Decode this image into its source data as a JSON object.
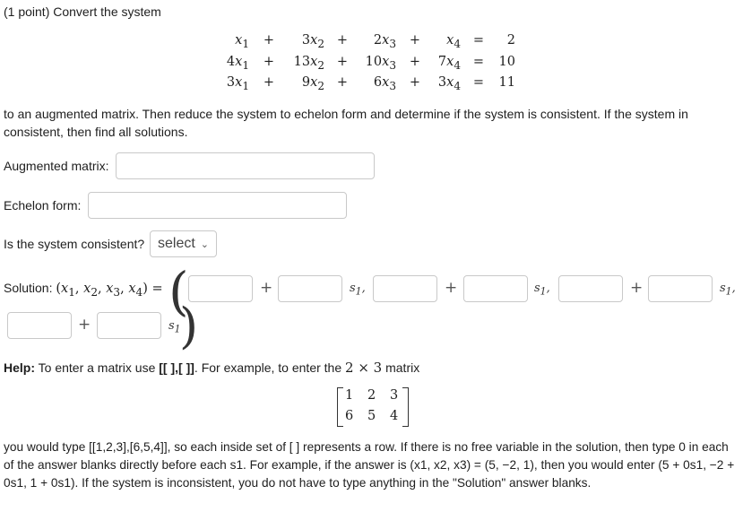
{
  "problem": {
    "points": "(1 point) Convert the system",
    "equations": [
      {
        "a": "x1",
        "op1": "+",
        "b": "3x2",
        "op2": "+",
        "c": "2x3",
        "op3": "+",
        "d": "x4",
        "eq": "=",
        "rhs": "2"
      },
      {
        "a": "4x1",
        "op1": "+",
        "b": "13x2",
        "op2": "+",
        "c": "10x3",
        "op3": "+",
        "d": "7x4",
        "eq": "=",
        "rhs": "10"
      },
      {
        "a": "3x1",
        "op1": "+",
        "b": "9x2",
        "op2": "+",
        "c": "6x3",
        "op3": "+",
        "d": "3x4",
        "eq": "=",
        "rhs": "11"
      }
    ],
    "instructions": "to an augmented matrix. Then reduce the system to echelon form and determine if the system is consistent. If the system in consistent, then find all solutions."
  },
  "form": {
    "augmented_label": "Augmented matrix:",
    "echelon_label": "Echelon form:",
    "consistent_label": "Is the system consistent?",
    "consistent_select": "select",
    "solution_label": "Solution:",
    "solution_tuple": "(x1, x2, x3, x4) =",
    "plus": "+",
    "s1_comma": "s1,",
    "s1": "s1"
  },
  "help": {
    "label": "Help:",
    "text_before": "To enter a matrix use",
    "syntax": "[[ ],[ ]]",
    "text_after": ". For example, to enter the",
    "dims": "2 × 3",
    "text_matrix": "matrix",
    "example_matrix": [
      [
        "1",
        "2",
        "3"
      ],
      [
        "6",
        "5",
        "4"
      ]
    ],
    "para": "you would type [[1,2,3],[6,5,4]], so each inside set of [ ] represents a row. If there is no free variable in the solution, then type 0 in each of the answer blanks directly before each s1. For example, if the answer is (x1, x2, x3) = (5, −2, 1), then you would enter (5 + 0s1, −2 + 0s1, 1 + 0s1). If the system is inconsistent, you do not have to type anything in the \"Solution\" answer blanks."
  }
}
